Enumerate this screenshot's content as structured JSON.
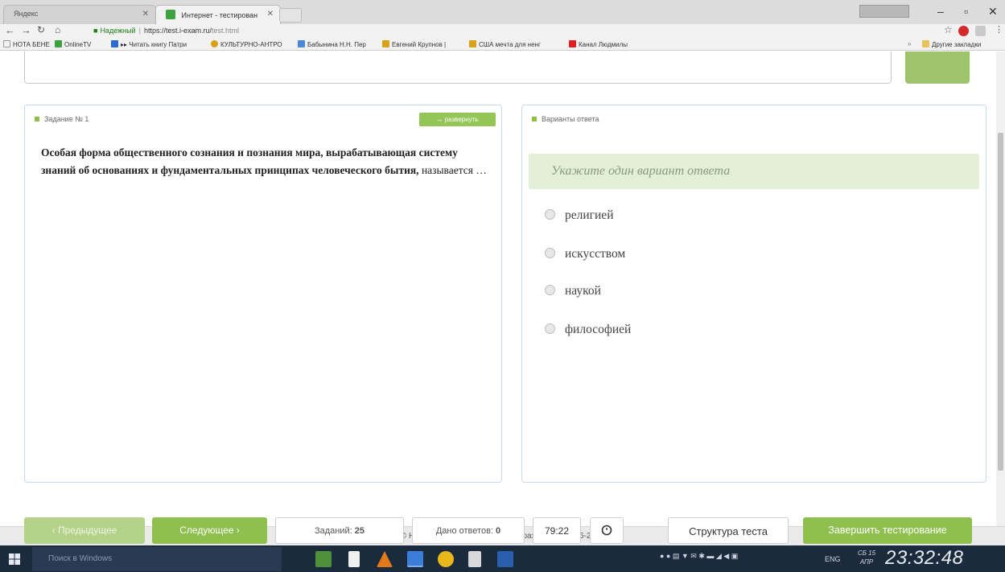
{
  "browser": {
    "tabs": [
      {
        "label": "Яндекс",
        "active": false
      },
      {
        "label": "Интернет - тестирован",
        "active": true
      }
    ],
    "address": {
      "secure_label": "Надежный",
      "url_domain": "https://test.i-exam.ru/",
      "url_path": "test.html"
    },
    "bookmarks": [
      {
        "label": "НОТА БЕНЕ",
        "icon": "page-icon"
      },
      {
        "label": "OnlineTV",
        "icon": "tv-icon",
        "color": "#3ea33e"
      },
      {
        "label": "▸▸ Читать книгу Патри",
        "icon": "book-icon",
        "color": "#2a6ad1"
      },
      {
        "label": "КУЛЬТУРНО-АНТРО",
        "icon": "star-icon",
        "color": "#d8a21a"
      },
      {
        "label": "Бабынина Н.Н. Пер",
        "icon": "bird-icon",
        "color": "#4a8ad8"
      },
      {
        "label": "Евгений Крупнов |",
        "icon": "folder-icon",
        "color": "#d8a21a"
      },
      {
        "label": "США мечта для ненг",
        "icon": "folder-icon",
        "color": "#d8a21a"
      },
      {
        "label": "Канал Людмилы",
        "icon": "youtube-icon",
        "color": "#e02020"
      }
    ],
    "other_bookmarks": "Другие закладки"
  },
  "question": {
    "label": "Задание № 1",
    "expand_label": "↔ развернуть",
    "text_bold": "Особая форма общественного сознания и познания мира, вырабатывающая систему знаний об основаниях и фундаментальных принципах человеческого бытия,",
    "text_tail": " называется …"
  },
  "answers": {
    "label": "Варианты ответа",
    "instruction": "Укажите один вариант ответа",
    "options": [
      "религией",
      "искусством",
      "наукой",
      "философией"
    ]
  },
  "toolbar": {
    "prev_label": "‹ Предыдущее",
    "next_label": "Следующее ›",
    "tasks_label": "Заданий:",
    "tasks_value": "25",
    "answered_label": "Дано ответов:",
    "answered_value": "0",
    "timer": "79:22",
    "structure_label": "Структура теста",
    "finish_label": "Завершить тестирование"
  },
  "footer": {
    "copyright": "© НИИ мониторинга качества образования, 2006-2017"
  },
  "taskbar": {
    "search_placeholder": "Поиск в Windows",
    "lang": "ENG",
    "date_day": "СБ 15",
    "date_month": "АПР",
    "time": "23:32:48"
  },
  "colors": {
    "accent_green": "#8fc04f",
    "instruction_bg": "#e3efd8",
    "taskbar_bg": "#1c2a3e"
  }
}
